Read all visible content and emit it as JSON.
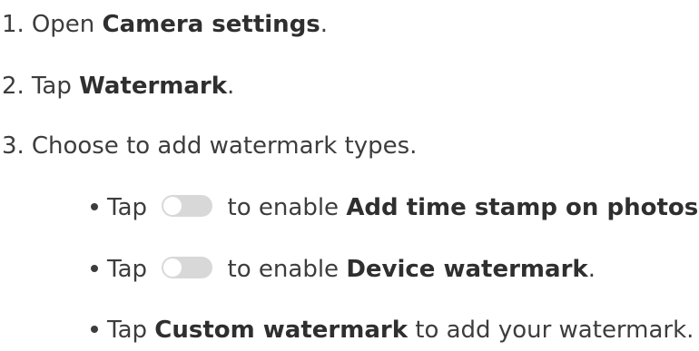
{
  "steps": [
    {
      "number": "1.",
      "prefix": "Open ",
      "bold": "Camera settings",
      "suffix": "."
    },
    {
      "number": "2.",
      "prefix": "Tap ",
      "bold": "Watermark",
      "suffix": "."
    },
    {
      "number": "3.",
      "text": "Choose to add watermark types."
    }
  ],
  "substeps": [
    {
      "prefix": "Tap ",
      "middle": " to enable ",
      "bold": "Add time stamp on photos",
      "suffix": ".",
      "icon": "toggle-off-icon",
      "toggle_state": "off"
    },
    {
      "prefix": "Tap ",
      "middle": " to enable ",
      "bold": "Device watermark",
      "suffix": ".",
      "icon": "toggle-off-icon",
      "toggle_state": "off"
    },
    {
      "prefix": "Tap ",
      "bold": "Custom watermark",
      "suffix": " to add your watermark."
    }
  ],
  "colors": {
    "text": "#3d3d3d",
    "toggle_track": "#d8d8d8",
    "toggle_knob": "#ffffff"
  }
}
